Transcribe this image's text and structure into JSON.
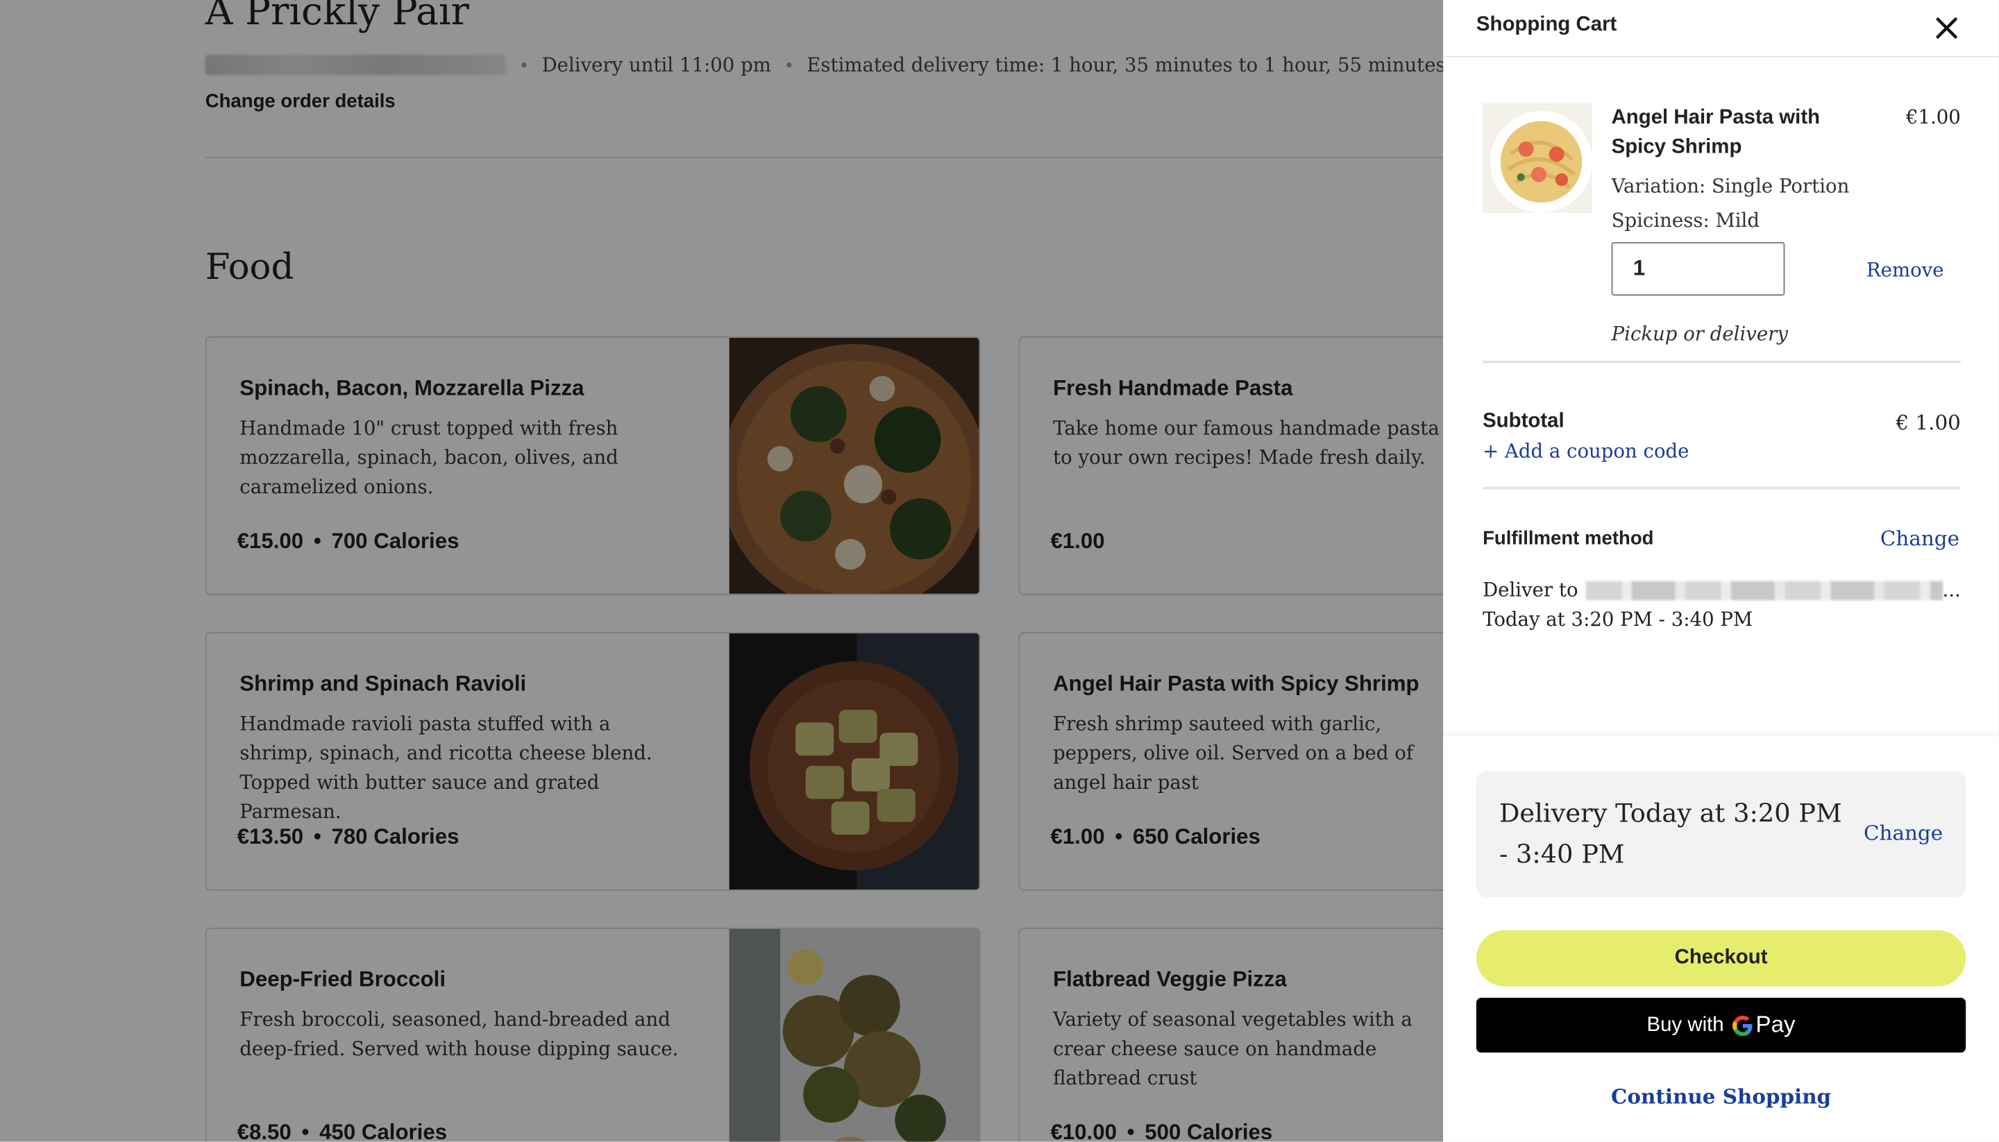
{
  "restaurant": {
    "name": "A Prickly Pair",
    "delivery_until": "Delivery until 11:00 pm",
    "estimated_delivery": "Estimated delivery time: 1 hour, 35 minutes to 1 hour, 55 minutes",
    "change_order_details": "Change order details"
  },
  "menu": {
    "section_title": "Food",
    "items": [
      {
        "name": "Spinach, Bacon, Mozzarella Pizza",
        "description": "Handmade 10\" crust topped with fresh mozzarella, spinach, bacon, olives, and caramelized onions.",
        "price": "€15.00",
        "calories": "700 Calories"
      },
      {
        "name": "Fresh Handmade Pasta",
        "description": "Take home our famous handmade pasta to your own recipes! Made fresh daily.",
        "price": "€1.00",
        "calories": ""
      },
      {
        "name": "Shrimp and Spinach Ravioli",
        "description": "Handmade ravioli pasta stuffed with a shrimp, spinach, and ricotta cheese blend. Topped with butter sauce and grated Parmesan.",
        "price": "€13.50",
        "calories": "780 Calories"
      },
      {
        "name": "Angel Hair Pasta with Spicy Shrimp",
        "description": "Fresh shrimp sauteed with garlic, peppers, olive oil. Served on a bed of angel hair past",
        "price": "€1.00",
        "calories": "650 Calories"
      },
      {
        "name": "Deep-Fried Broccoli",
        "description": "Fresh broccoli, seasoned, hand-breaded and deep-fried. Served with house dipping sauce.",
        "price": "€8.50",
        "calories": "450 Calories"
      },
      {
        "name": "Flatbread Veggie Pizza",
        "description": "Variety of seasonal vegetables with a crear cheese sauce on handmade flatbread crust",
        "price": "€10.00",
        "calories": "500 Calories"
      }
    ]
  },
  "cart": {
    "title": "Shopping Cart",
    "close_icon": "close-icon",
    "item": {
      "name": "Angel Hair Pasta with Spicy Shrimp",
      "price": "€1.00",
      "variation": "Variation: Single Portion",
      "spiciness": "Spiciness: Mild",
      "quantity": "1",
      "remove_label": "Remove",
      "fulfillment_note": "Pickup or delivery"
    },
    "subtotal_label": "Subtotal",
    "subtotal_value": "€ 1.00",
    "coupon_link": "+ Add a coupon code",
    "fulfillment_label": "Fulfillment method",
    "fulfillment_change": "Change",
    "deliver_to_label": "Deliver to",
    "deliver_to_ellipsis": "...",
    "deliver_time": "Today at 3:20 PM - 3:40 PM",
    "delivery_box_text": "Delivery Today at 3:20 PM - 3:40 PM",
    "delivery_box_change": "Change",
    "checkout_label": "Checkout",
    "gpay_prefix": "Buy with",
    "gpay_g": "G",
    "gpay_word": "Pay",
    "continue_label": "Continue Shopping"
  },
  "colors": {
    "link": "#1a3d9a",
    "checkout_button": "#e6ec6c",
    "overlay": "rgba(0,0,0,0.42)"
  }
}
